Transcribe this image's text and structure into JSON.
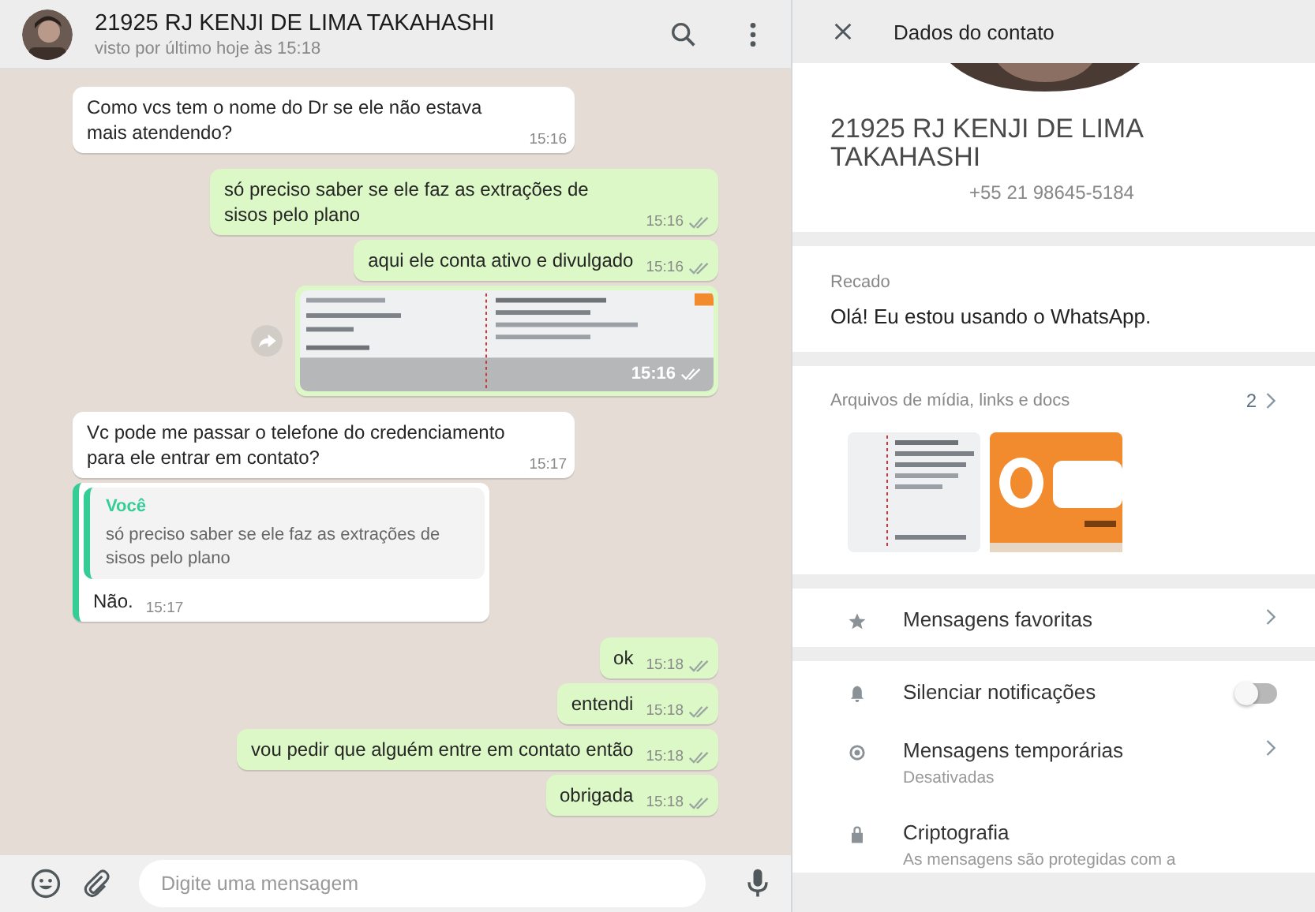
{
  "chat_header": {
    "title": "21925 RJ KENJI DE LIMA TAKAHASHI",
    "subtitle": "visto por último hoje às 15:18"
  },
  "messages": [
    {
      "kind": "text",
      "outgoing": false,
      "text": "Como vcs tem o nome do Dr se ele não estava mais atendendo?",
      "time": "15:16"
    },
    {
      "kind": "text",
      "outgoing": true,
      "text": "só preciso saber se ele faz as extrações de sisos pelo plano",
      "time": "15:16",
      "read": false
    },
    {
      "kind": "text",
      "outgoing": true,
      "text": "aqui ele conta ativo e divulgado",
      "time": "15:16",
      "read": false
    },
    {
      "outgoing": true,
      "time": "15:16",
      "read": false
    },
    {
      "kind": "text",
      "outgoing": false,
      "text": "Vc pode me passar o telefone do credenciamento para ele entrar em contato?",
      "time": "15:17"
    },
    {
      "kind": "quote",
      "outgoing": false,
      "quote_author": "Você",
      "quote_text": "só preciso saber se ele faz as extrações de sisos pelo plano",
      "text": "Não.",
      "time": "15:17"
    },
    {
      "kind": "text",
      "outgoing": true,
      "text": "ok",
      "time": "15:18",
      "read": false
    },
    {
      "kind": "text",
      "outgoing": true,
      "text": "entendi",
      "time": "15:18",
      "read": false
    },
    {
      "kind": "text",
      "outgoing": true,
      "text": "vou pedir que alguém entre em contato então",
      "time": "15:18",
      "read": false
    },
    {
      "kind": "text",
      "outgoing": true,
      "text": "obrigada",
      "time": "15:18",
      "read": false
    }
  ],
  "composer": {
    "placeholder": "Digite uma mensagem"
  },
  "contact_panel": {
    "title": "Dados do contato",
    "name": "21925 RJ KENJI DE LIMA TAKAHASHI",
    "phone": "+55 21 98645-5184",
    "about": {
      "label": "Recado",
      "text": "Olá! Eu estou usando o WhatsApp."
    },
    "media": {
      "label": "Arquivos de mídia, links e docs",
      "count": "2"
    },
    "rows": [
      {
        "kind": "link",
        "label": "Mensagens favoritas"
      },
      {
        "kind": "toggle",
        "label": "Silenciar notificações",
        "on": false
      },
      {
        "kind": "link",
        "label": "Mensagens temporárias",
        "sublabel": "Desativadas"
      },
      {
        "kind": "info",
        "label": "Criptografia",
        "sublabel": "As mensagens são protegidas com a"
      }
    ]
  }
}
